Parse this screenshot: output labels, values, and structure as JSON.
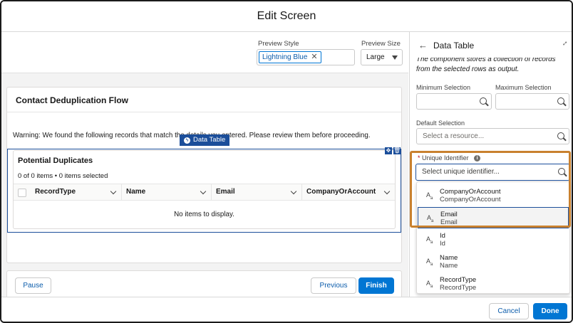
{
  "modal": {
    "title": "Edit Screen"
  },
  "preview": {
    "style_label": "Preview Style",
    "style_value": "Lightning Blue",
    "size_label": "Preview Size",
    "size_value": "Large"
  },
  "screen": {
    "card_title": "Contact Deduplication Flow",
    "warning": "Warning: We found the following records that match the details you entered. Please review them before proceeding.",
    "component_tag": "Data Table",
    "table": {
      "heading": "Potential Duplicates",
      "count": "0 of 0 items • 0 items selected",
      "columns": [
        "RecordType",
        "Name",
        "Email",
        "CompanyOrAccount"
      ],
      "empty": "No items to display."
    },
    "buttons": {
      "pause": "Pause",
      "previous": "Previous",
      "finish": "Finish"
    }
  },
  "panel": {
    "title": "Data Table",
    "description": "The component stores a collection of records from the selected rows as output.",
    "min_label": "Minimum Selection",
    "max_label": "Maximum Selection",
    "default_label": "Default Selection",
    "default_placeholder": "Select a resource...",
    "unique_label": "Unique Identifier",
    "unique_required": "*",
    "unique_placeholder": "Select unique identifier...",
    "type_glyph": "A",
    "type_glyph_sub": "a",
    "options": [
      {
        "label": "CompanyOrAccount",
        "sub": "CompanyOrAccount"
      },
      {
        "label": "Email",
        "sub": "Email"
      },
      {
        "label": "Id",
        "sub": "Id"
      },
      {
        "label": "Name",
        "sub": "Name"
      },
      {
        "label": "RecordType",
        "sub": "RecordType"
      }
    ]
  },
  "footer": {
    "cancel": "Cancel",
    "done": "Done"
  },
  "colors": {
    "brand": "#0176d3",
    "selected_border": "#1b4e9a",
    "highlight": "#c9812f"
  }
}
